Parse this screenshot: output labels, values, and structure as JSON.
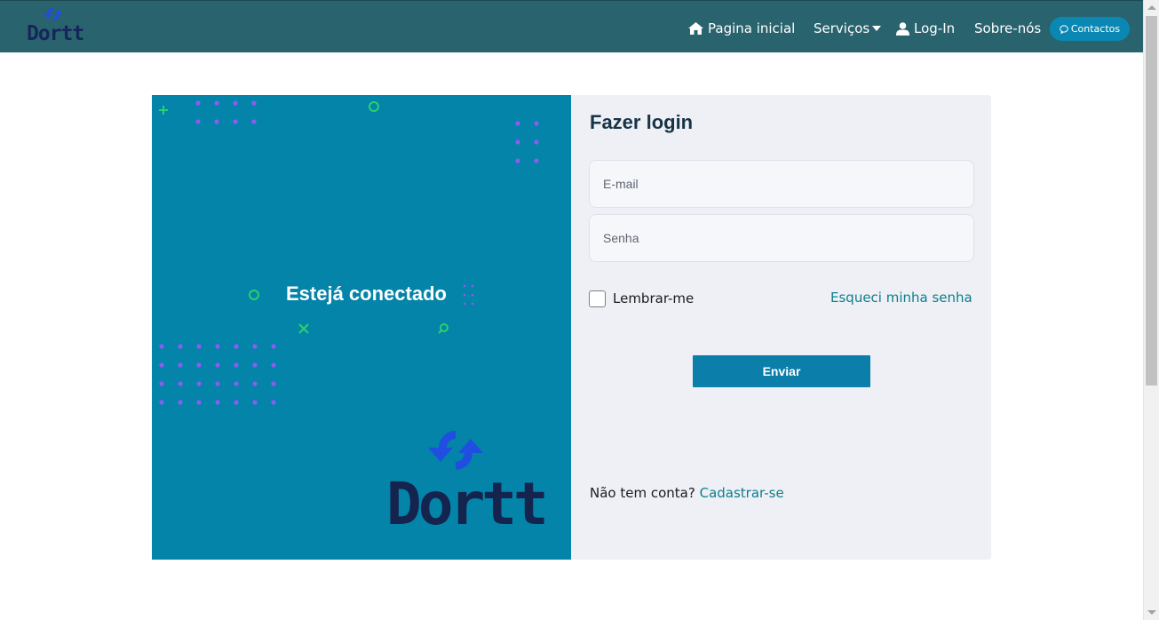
{
  "nav": {
    "brand": "Dortt",
    "home": "Pagina inicial",
    "services": "Serviços",
    "login": "Log-In",
    "about": "Sobre-nós",
    "contact": "Contactos"
  },
  "hero": {
    "title": "Estejá conectado",
    "logo_text": "Dortt"
  },
  "form": {
    "title": "Fazer login",
    "email_placeholder": "E-mail",
    "password_placeholder": "Senha",
    "remember_label": "Lembrar-me",
    "forgot_link": "Esqueci minha senha",
    "submit_label": "Enviar",
    "no_account": "Não tem conta?",
    "signup_link": "Cadastrar-se"
  },
  "colors": {
    "navbar": "#29636e",
    "panel": "#0384a8",
    "accent": "#0b7ea9",
    "link": "#0b7f8a",
    "dots": "#8f5bf2",
    "shapes": "#2ad16f"
  }
}
